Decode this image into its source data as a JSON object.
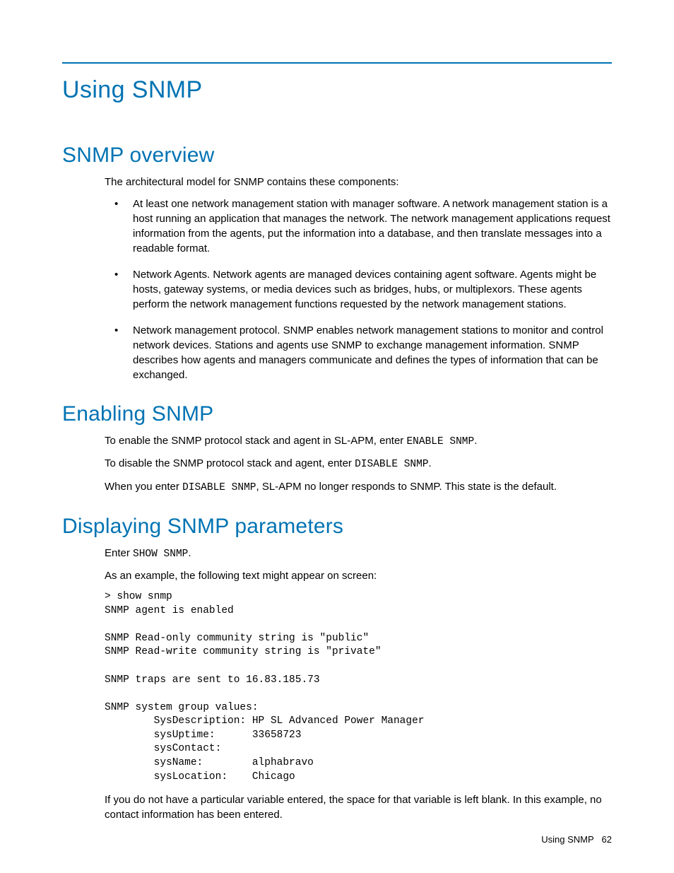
{
  "title": "Using SNMP",
  "sections": {
    "overview": {
      "heading": "SNMP overview",
      "intro": "The architectural model for SNMP contains these components:",
      "bullets": [
        "At least one network management station with manager software. A network management station is a host running an application that manages the network. The network management applications request information from the agents, put the information into a database, and then translate messages into a readable format.",
        "Network Agents. Network agents are managed devices containing agent software. Agents might be hosts, gateway systems, or media devices such as bridges, hubs, or multiplexors. These agents perform the network management functions requested by the network management stations.",
        "Network management protocol. SNMP enables network management stations to monitor and control network devices. Stations and agents use SNMP to exchange management information. SNMP describes how agents and managers communicate and defines the types of information that can be exchanged."
      ]
    },
    "enabling": {
      "heading": "Enabling SNMP",
      "p1a": "To enable the SNMP protocol stack and agent in SL-APM, enter ",
      "p1code": "ENABLE SNMP",
      "p1b": ".",
      "p2a": "To disable the SNMP protocol stack and agent, enter ",
      "p2code": "DISABLE SNMP",
      "p2b": ".",
      "p3a": "When you enter ",
      "p3code": "DISABLE SNMP",
      "p3b": ", SL-APM no longer responds to SNMP. This state is the default."
    },
    "displaying": {
      "heading": "Displaying SNMP parameters",
      "p1a": "Enter ",
      "p1code": "SHOW SNMP",
      "p1b": ".",
      "p2": "As an example, the following text might appear on screen:",
      "pre": "> show snmp\nSNMP agent is enabled\n\nSNMP Read-only community string is \"public\"\nSNMP Read-write community string is \"private\"\n\nSNMP traps are sent to 16.83.185.73\n\nSNMP system group values:\n        SysDescription: HP SL Advanced Power Manager\n        sysUptime:      33658723\n        sysContact:\n        sysName:        alphabravo\n        sysLocation:    Chicago",
      "p3": "If you do not have a particular variable entered, the space for that variable is left blank. In this example, no contact information has been entered."
    }
  },
  "footer": {
    "label": "Using SNMP",
    "page": "62"
  }
}
